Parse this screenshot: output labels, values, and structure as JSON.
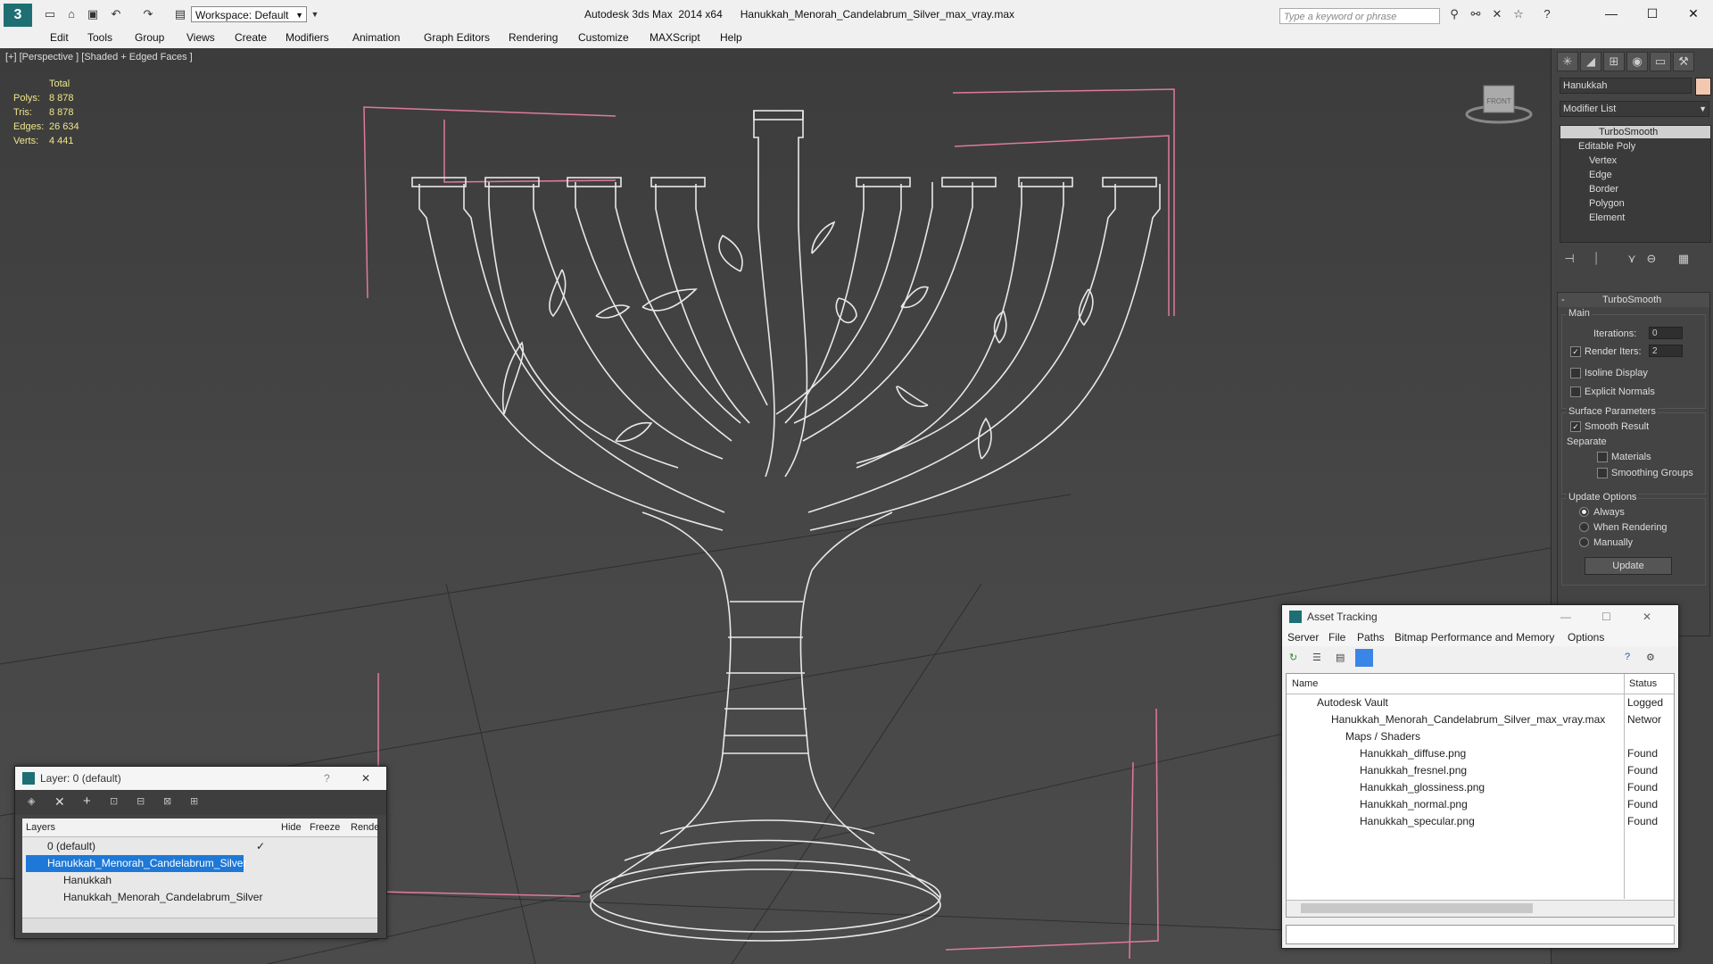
{
  "app": {
    "title": "Autodesk 3ds Max  2014 x64      Hanukkah_Menorah_Candelabrum_Silver_max_vray.max",
    "workspace": "Workspace: Default",
    "search_placeholder": "Type a keyword or phrase"
  },
  "menu": [
    "Edit",
    "Tools",
    "Group",
    "Views",
    "Create",
    "Modifiers",
    "Animation",
    "Graph Editors",
    "Rendering",
    "Customize",
    "MAXScript",
    "Help"
  ],
  "viewport": {
    "label": "[+] [Perspective ] [Shaded + Edged Faces ]",
    "stats": {
      "header": "Total",
      "rows": [
        {
          "label": "Polys:",
          "value": "8 878"
        },
        {
          "label": "Tris:",
          "value": "8 878"
        },
        {
          "label": "Edges:",
          "value": "26 634"
        },
        {
          "label": "Verts:",
          "value": "4 441"
        }
      ]
    },
    "viewcube_label": "FRONT"
  },
  "command_panel": {
    "object_name": "Hanukkah",
    "modifier_list": "Modifier List",
    "object_color": "#f2c9b0",
    "stack": [
      "TurboSmooth",
      "Editable Poly",
      "Vertex",
      "Edge",
      "Border",
      "Polygon",
      "Element"
    ],
    "turbosmooth": {
      "title": "TurboSmooth",
      "main": "Main",
      "iterations_label": "Iterations:",
      "iterations": "0",
      "render_iters_label": "Render Iters:",
      "render_iters": "2",
      "render_iters_checked": true,
      "isoline": "Isoline Display",
      "explicit_normals": "Explicit Normals",
      "surface_params": "Surface Parameters",
      "smooth_result": "Smooth Result",
      "separate": "Separate",
      "materials": "Materials",
      "smoothing_groups": "Smoothing Groups",
      "update_options": "Update Options",
      "always": "Always",
      "when_rendering": "When Rendering",
      "manually": "Manually",
      "update_button": "Update"
    }
  },
  "layer_window": {
    "title": "Layer: 0 (default)",
    "columns": [
      "Layers",
      "Hide",
      "Freeze",
      "Rende"
    ],
    "rows": [
      {
        "name": "0 (default)",
        "indent": 1,
        "selected": false,
        "active": true
      },
      {
        "name": "Hanukkah_Menorah_Candelabrum_Silver",
        "indent": 1,
        "selected": true,
        "active": false
      },
      {
        "name": "Hanukkah",
        "indent": 2,
        "selected": false,
        "active": false
      },
      {
        "name": "Hanukkah_Menorah_Candelabrum_Silver",
        "indent": 2,
        "selected": false,
        "active": false
      }
    ]
  },
  "asset_window": {
    "title": "Asset Tracking",
    "menu": [
      "Server",
      "File",
      "Paths",
      "Bitmap Performance and Memory",
      "Options"
    ],
    "columns": [
      "Name",
      "Status"
    ],
    "rows": [
      {
        "name": "Autodesk Vault",
        "status": "Logged",
        "indent": 1
      },
      {
        "name": "Hanukkah_Menorah_Candelabrum_Silver_max_vray.max",
        "status": "Networ",
        "indent": 2
      },
      {
        "name": "Maps / Shaders",
        "status": "",
        "indent": 3
      },
      {
        "name": "Hanukkah_diffuse.png",
        "status": "Found",
        "indent": 4
      },
      {
        "name": "Hanukkah_fresnel.png",
        "status": "Found",
        "indent": 4
      },
      {
        "name": "Hanukkah_glossiness.png",
        "status": "Found",
        "indent": 4
      },
      {
        "name": "Hanukkah_normal.png",
        "status": "Found",
        "indent": 4
      },
      {
        "name": "Hanukkah_specular.png",
        "status": "Found",
        "indent": 4
      }
    ]
  }
}
